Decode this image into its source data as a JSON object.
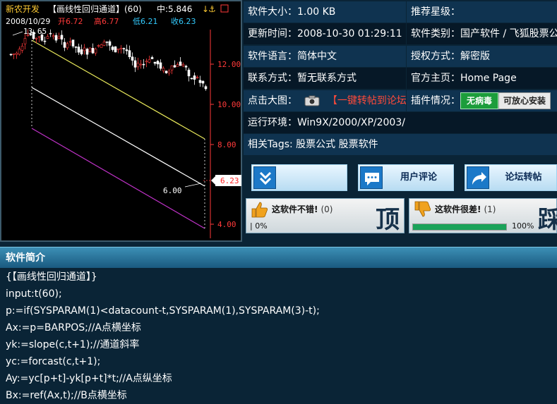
{
  "chart": {
    "name": "新农开发",
    "indicator": "【画线性回归通道】(60)",
    "mid_label": "中:5.846",
    "date": "2008/10/29",
    "open_label": "开6.72",
    "high_label": "高6.77",
    "low_label": "低6.21",
    "close_label": "收6.23",
    "top_price_label": "13.65",
    "bottom_price_label": "6.00",
    "current_price": "6.23",
    "y_axis_labels": [
      "12.00",
      "10.00",
      "8.00",
      "4.00"
    ]
  },
  "info": {
    "size_label": "软件大小：",
    "size_value": "1.00 KB",
    "rating_label": "推荐星级：",
    "updated_label": "更新时间：",
    "updated_value": "2008-10-30 01:29:11",
    "category_label": "软件类别：",
    "category_value": "国产软件 / 飞狐股票公",
    "language_label": "软件语言：",
    "language_value": "简体中文",
    "license_label": "授权方式：",
    "license_value": "解密版",
    "contact_label": "联系方式：",
    "contact_value": "暂无联系方式",
    "homepage_label": "官方主页：",
    "homepage_value": "Home Page",
    "bigimage_label": "点击大图：",
    "repost_link": "【一键转帖到论坛】",
    "plugin_label": "插件情况：",
    "novirus_badge": "无病毒",
    "safe_badge": "可放心安装",
    "env_label": "运行环境：",
    "env_value": "Win9X/2000/XP/2003/",
    "tags_label": "相关Tags:",
    "tags_value": "股票公式 股票软件"
  },
  "actions": {
    "review_label": "用户评论",
    "forum_label": "论坛转帖"
  },
  "votes": {
    "good": {
      "title": "这软件不错!",
      "count": "(0)",
      "big": "顶",
      "percent": "0%",
      "percent_value": 0
    },
    "bad": {
      "title": "这软件很差!",
      "count": "(1)",
      "big": "踩",
      "percent": "100%",
      "percent_value": 100
    }
  },
  "intro": {
    "title": "软件简介",
    "lines": [
      "{【画线性回归通道】}",
      "input:t(60);",
      "p:=if(SYSPARAM(1)<datacount-t,SYSPARAM(1),SYSPARAM(3)-t);",
      "Ax:=p=BARPOS;//A点横坐标",
      "yk:=slope(c,t+1);//通道斜率",
      "yc:=forcast(c,t+1);",
      "Ay:=yc[p+t]-yk[p+t]*t;//A点纵坐标",
      "Bx:=ref(Ax,t);//B点横坐标"
    ]
  },
  "colors": {
    "chart_up": "#ff3a3a",
    "chart_down": "#ffffff",
    "channel_top": "#e8e85a",
    "channel_bottom": "#c032c8",
    "header_blue": "#1a5a80"
  }
}
